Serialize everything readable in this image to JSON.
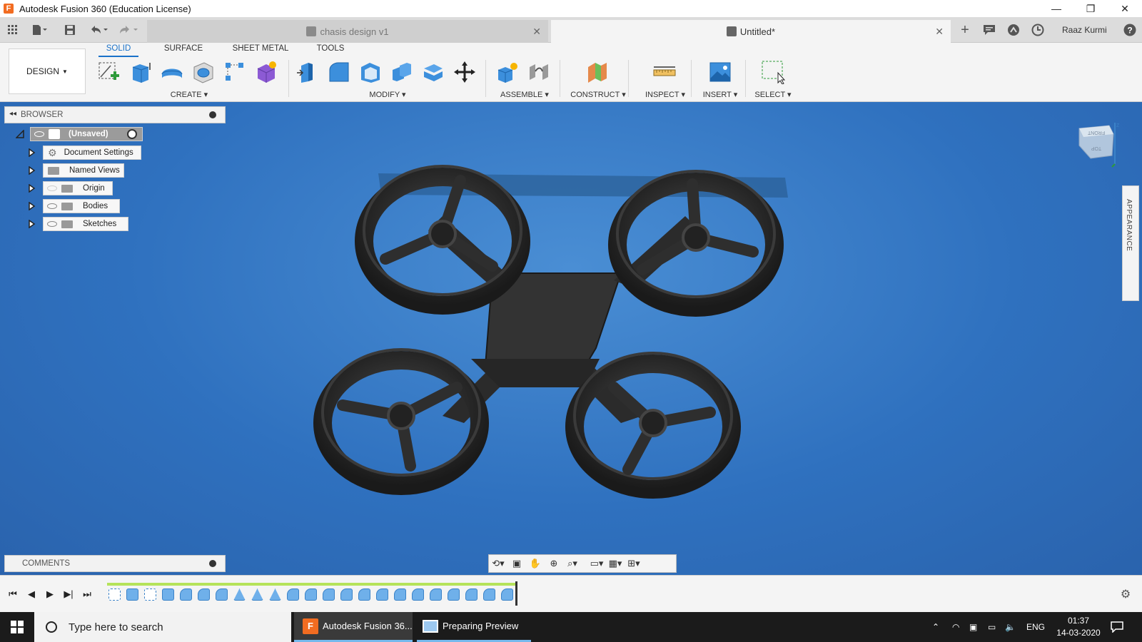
{
  "window": {
    "title": "Autodesk Fusion 360 (Education License)",
    "app_icon_letter": "F",
    "minimize": "—",
    "restore": "❐",
    "close": "✕"
  },
  "tabs": {
    "inactive_label": "chasis design v1",
    "active_label": "Untitled*",
    "close_glyph": "✕",
    "new_tab": "+",
    "user": "Raaz Kurmi",
    "help": "?"
  },
  "ribbon": {
    "workspace": "DESIGN",
    "tabs": [
      "SOLID",
      "SURFACE",
      "SHEET METAL",
      "TOOLS"
    ],
    "groups": [
      "CREATE",
      "MODIFY",
      "ASSEMBLE",
      "CONSTRUCT",
      "INSPECT",
      "INSERT",
      "SELECT"
    ],
    "accent": "#1a72c9"
  },
  "browser": {
    "title": "BROWSER",
    "root": "(Unsaved)",
    "items": [
      "Document Settings",
      "Named Views",
      "Origin",
      "Bodies",
      "Sketches"
    ]
  },
  "comments": {
    "title": "COMMENTS"
  },
  "appearance_panel": {
    "label": "APPEARANCE"
  },
  "viewcube": {
    "front": "FRONT",
    "top": "TOP",
    "z_axis": "Z"
  },
  "taskbar": {
    "search_placeholder": "Type here to search",
    "apps": [
      "Autodesk Fusion 36...",
      "Preparing Preview"
    ],
    "language": "ENG",
    "time": "01:37",
    "date": "14-03-2020"
  },
  "colors": {
    "canvas": "#3a7ccc",
    "model": "#2b2b2b",
    "timeline_track": "#b5e35a"
  }
}
